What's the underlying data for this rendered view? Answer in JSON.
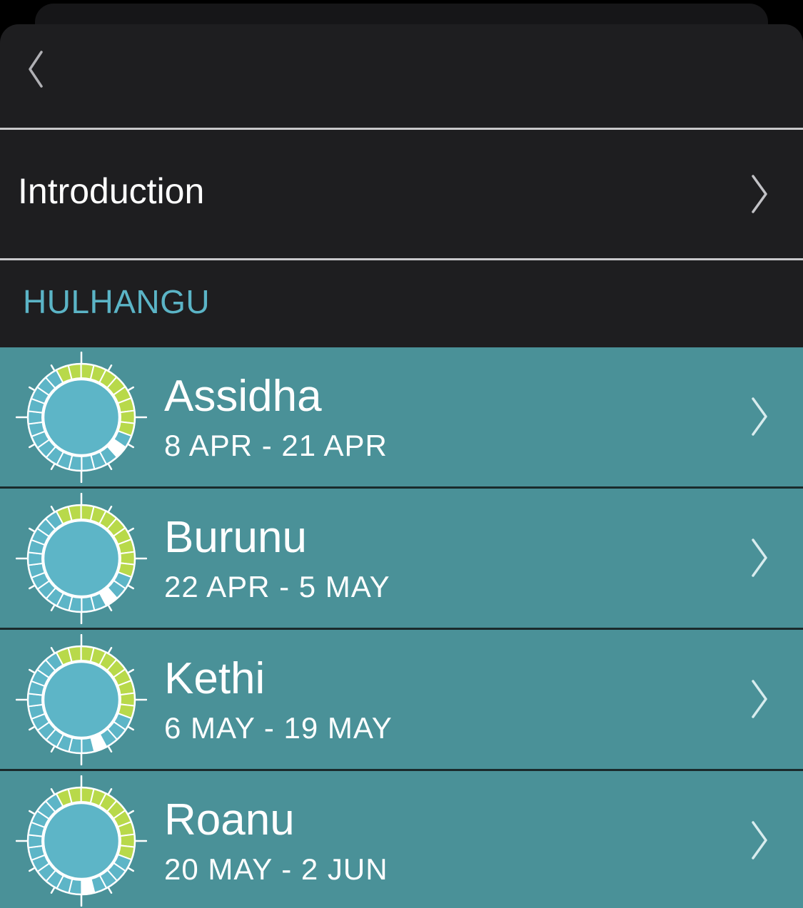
{
  "nav": {
    "back_icon": "chevron-left-icon"
  },
  "intro": {
    "label": "Introduction",
    "chevron_icon": "chevron-right-icon"
  },
  "section": {
    "title": "HULHANGU"
  },
  "colors": {
    "row_background": "#4a9198",
    "dial_center": "#5db5c7",
    "active_segment": "#b8d94a",
    "current_segment": "#ffffff",
    "section_title": "#5bb4c6"
  },
  "seasons": [
    {
      "name": "Assidha",
      "dates": "8 APR - 21 APR",
      "current_segment": 0
    },
    {
      "name": "Burunu",
      "dates": "22 APR - 5 MAY",
      "current_segment": 1
    },
    {
      "name": "Kethi",
      "dates": "6 MAY - 19 MAY",
      "current_segment": 2
    },
    {
      "name": "Roanu",
      "dates": "20 MAY - 2 JUN",
      "current_segment": 3
    }
  ]
}
